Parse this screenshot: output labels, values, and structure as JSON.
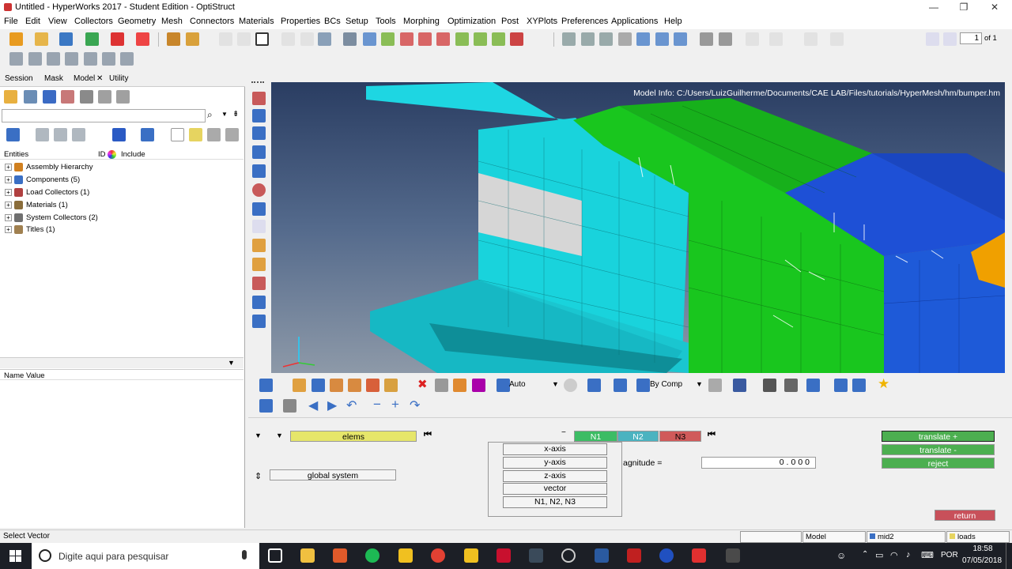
{
  "window": {
    "title": "Untitled - HyperWorks 2017 - Student Edition - OptiStruct",
    "minimize": "—",
    "maximize": "❐",
    "close": "✕"
  },
  "menu": [
    "File",
    "Edit",
    "View",
    "Collectors",
    "Geometry",
    "Mesh",
    "Connectors",
    "Materials",
    "Properties",
    "BCs",
    "Setup",
    "Tools",
    "Morphing",
    "Optimization",
    "Post",
    "XYPlots",
    "Preferences",
    "Applications",
    "Help"
  ],
  "page_nav": {
    "value": "1",
    "of": "of 1"
  },
  "left_tabs": [
    "Session",
    "Mask",
    "Model",
    "Utility"
  ],
  "model_tab_close": "✕",
  "entities_header": {
    "entities": "Entities",
    "id": "ID",
    "include": "Include"
  },
  "tree": [
    {
      "label": "Assembly Hierarchy",
      "color": "#d08020"
    },
    {
      "label": "Components (5)",
      "color": "#3a6fc4"
    },
    {
      "label": "Load Collectors (1)",
      "color": "#b04040"
    },
    {
      "label": "Materials (1)",
      "color": "#8a6d3b"
    },
    {
      "label": "System Collectors (2)",
      "color": "#707070"
    },
    {
      "label": "Titles (1)",
      "color": "#a08050"
    }
  ],
  "name_value_header": "Name Value",
  "viewport": {
    "model_info": "Model Info: C:/Users/LuizGuilherme/Documents/CAE LAB/Files/tutorials/HyperMesh/hm/bumper.hm"
  },
  "view_toolbar": {
    "auto": "Auto",
    "by_comp": "By Comp"
  },
  "panel": {
    "elems": "elems",
    "global_system": "global system",
    "n1": "N1",
    "n2": "N2",
    "n3": "N3",
    "magnitude_label": "agnitude =",
    "magnitude_value": "0.000",
    "translate_plus": "translate +",
    "translate_minus": "translate -",
    "reject": "reject",
    "return": "return",
    "dropdown": [
      "x-axis",
      "y-axis",
      "z-axis",
      "vector",
      "N1, N2, N3"
    ]
  },
  "status": {
    "text": "Select Vector",
    "model": "Model",
    "comp": "mid2",
    "loads": "loads"
  },
  "taskbar": {
    "search_placeholder": "Digite aqui para pesquisar",
    "lang": "POR",
    "time": "18:58",
    "date": "07/05/2018"
  },
  "colors": {
    "cyan": "#19d3dc",
    "green": "#19c61e",
    "blue": "#1e50d6",
    "orange": "#f0a000",
    "gray": "#d8d8d8"
  }
}
